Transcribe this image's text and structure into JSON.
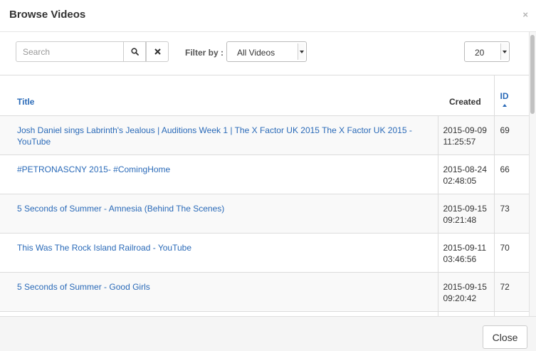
{
  "modal": {
    "title": "Browse Videos",
    "close_x": "×"
  },
  "toolbar": {
    "search_placeholder": "Search",
    "search_value": "",
    "filter_label": "Filter by :",
    "filter_value": "All Videos",
    "per_page_value": "20"
  },
  "table": {
    "headers": {
      "title": "Title",
      "created": "Created",
      "id": "ID"
    },
    "sort": {
      "column": "id",
      "direction": "ascending"
    },
    "rows": [
      {
        "title": "Josh Daniel sings Labrinth's Jealous | Auditions Week 1 | The X Factor UK 2015 The X Factor UK 2015 - YouTube",
        "date": "2015-09-09",
        "time": "11:25:57",
        "id": "69"
      },
      {
        "title": "#PETRONASCNY 2015- #ComingHome",
        "date": "2015-08-24",
        "time": "02:48:05",
        "id": "66"
      },
      {
        "title": "5 Seconds of Summer - Amnesia (Behind The Scenes)",
        "date": "2015-09-15",
        "time": "09:21:48",
        "id": "73"
      },
      {
        "title": "This Was The Rock Island Railroad - YouTube",
        "date": "2015-09-11",
        "time": "03:46:56",
        "id": "70"
      },
      {
        "title": "5 Seconds of Summer - Good Girls",
        "date": "2015-09-15",
        "time": "09:20:42",
        "id": "72"
      },
      {
        "title": "",
        "date": "",
        "time": "",
        "id": ""
      }
    ]
  },
  "footer": {
    "close_label": "Close"
  },
  "colors": {
    "link": "#2a6ab8",
    "header_border": "#e5e5e5",
    "footer_bg": "#f5f5f5",
    "row_stripe": "#f9f9f9"
  },
  "icons": {
    "search_button": "search-icon",
    "clear_button": "close-icon",
    "sort": "sort-ascending-icon"
  }
}
